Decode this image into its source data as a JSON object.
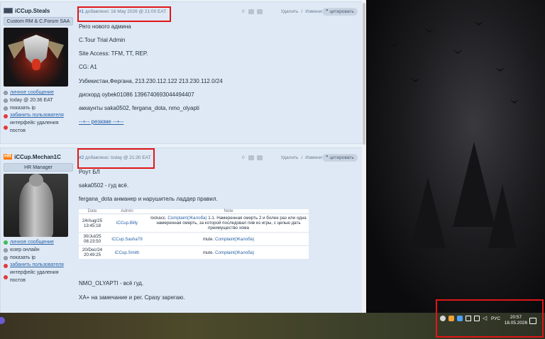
{
  "posts": [
    {
      "username": "iCCup.Steals",
      "role": "Custom RM & C.Forum SAA",
      "links": [
        {
          "label": "личное сообщение",
          "icon": "grey-circle-icon",
          "link": true
        },
        {
          "label": "today @ 20:36 EAT",
          "icon": "grey-circle-icon",
          "link": false
        },
        {
          "label": "показать ip",
          "icon": "grey-circle-icon",
          "link": false
        },
        {
          "label": "забанить пользователя",
          "icon": "red-circle-icon",
          "link": true
        },
        {
          "label": "интерфейс удаления постов",
          "icon": "red-circle-icon",
          "link": false
        }
      ],
      "meta_num": "#1",
      "meta_date": " добавлено: 16 May 2026 @ 21:00 EAT",
      "score": "0",
      "delete": "Удалить",
      "slash": "/",
      "edit": "Изменить",
      "quote": "цитировать",
      "lines": [
        "Рего нового админа",
        "C.Tour Trial Admin",
        "Site Access: TFM, TT, REP.",
        "CG: A1",
        "Узбекистан,Фергана, 213.230.112.122 213.230.112.0/24",
        "дискорд oybek01086 1396740693044494407",
        "аккаунты saka0502, fergana_dota, nmo_olyapti"
      ],
      "signature": "--+-- резюме --+--"
    },
    {
      "username": "iCCup.Mechan1C",
      "badge": "HR",
      "role": "HR Manager",
      "links": [
        {
          "label": "личное сообщение",
          "icon": "green-circle-icon",
          "link": true
        },
        {
          "label": "юзер онлайн",
          "icon": "grey-circle-icon",
          "link": false
        },
        {
          "label": "показать ip",
          "icon": "grey-circle-icon",
          "link": false
        },
        {
          "label": "забанить пользователя",
          "icon": "red-circle-icon",
          "link": true
        },
        {
          "label": "интерфейс удаления постов",
          "icon": "red-circle-icon",
          "link": false
        }
      ],
      "meta_num": "#2",
      "meta_date": " добавлено: today @ 21:30 EAT",
      "score": "0",
      "delete": "Удалить",
      "slash": "/",
      "edit": "Изменить",
      "quote": "цитировать",
      "lines_top": [
        "Роут БЛ",
        "saka0502 - гуд всё.",
        "fergana_dota анманер и нарушитель ладдер правил."
      ],
      "table": {
        "headers": [
          "Date",
          "Admin",
          "Note"
        ],
        "rows": [
          {
            "date": "24/Aug/25 13:45:18",
            "admin": "iCCup.Billy",
            "note_prefix": "lockacc. ",
            "note_link": "Complaint(Жалоба)",
            "note_suffix": " 1.1. Намеренная смерть 2 и более раз или одна намеренная смерть, за которой последовал пив из игры, с целью дать преимущество хома"
          },
          {
            "date": "30/Jul/25 08:23:50",
            "admin": "iCCup.Sasha79",
            "note_prefix": "mute. ",
            "note_link": "Complaint(Жалоба)",
            "note_suffix": ""
          },
          {
            "date": "20/Dec/24 20:49:25",
            "admin": "iCCup.Smith",
            "note_prefix": "mute. ",
            "note_link": "Complaint(Жалоба)",
            "note_suffix": ""
          }
        ]
      },
      "lines_bottom": [
        "NMO_OLYAPTI - всё гуд.",
        "XA+ на замечание и рег. Сразу зарегаю."
      ]
    }
  ],
  "taskbar": {
    "lang": "РУС",
    "time": "20:57",
    "date": "18.05.2026"
  },
  "colors": {
    "highlight_box": "#e01616",
    "link": "#2a63a8",
    "post_bg": "#dfe9f5"
  }
}
